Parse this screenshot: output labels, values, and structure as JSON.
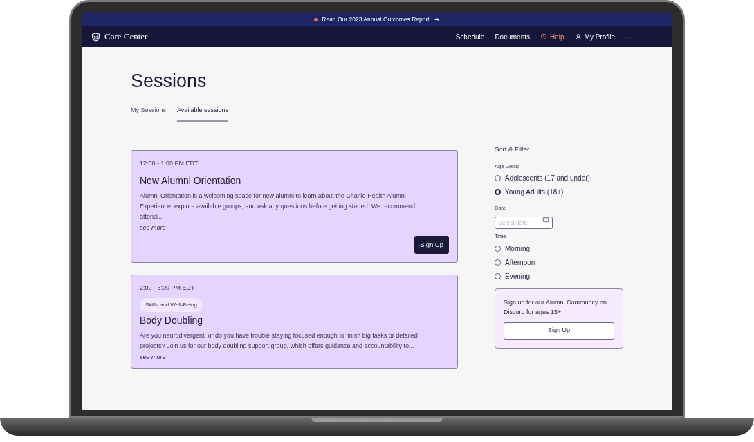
{
  "banner": {
    "text": "Read Our 2023 Annual Outcomes Report"
  },
  "nav": {
    "brand": "Care Center",
    "links": [
      {
        "label": "Schedule",
        "kind": "plain"
      },
      {
        "label": "Documents",
        "kind": "plain"
      },
      {
        "label": "Help",
        "kind": "help"
      },
      {
        "label": "My Profile",
        "kind": "profile"
      },
      {
        "label": "···",
        "kind": "more"
      }
    ]
  },
  "page": {
    "title": "Sessions",
    "tabs": [
      {
        "label": "My Sessions",
        "selected": false
      },
      {
        "label": "Available sessions",
        "selected": true
      }
    ]
  },
  "sessions": [
    {
      "time": "12:00 - 1:00 PM EDT",
      "title": "New Alumni Orientation",
      "description": "Alumni Orientation is a welcoming space for new alumni to learn about the Charlie Health Alumni Experience, explore available groups, and ask any questions before getting started. We recommend attendi...",
      "see_more": "see more",
      "button": "Sign Up"
    },
    {
      "time": "2:00 - 3:00 PM EDT",
      "tag": "Skills and Well-Being",
      "title": "Body Doubling",
      "description": "Are you neurodivergent, or do you have trouble staying focused enough to finish big tasks or detailed projects? Join us for our body doubling support group, which offers guidance and accountability to...",
      "see_more": "see more"
    }
  ],
  "filter": {
    "title": "Sort & Filter",
    "age_group": {
      "label": "Age Group",
      "options": [
        {
          "label": "Adolescents (17 and under)",
          "selected": false
        },
        {
          "label": "Young Adults (18+)",
          "selected": true
        }
      ]
    },
    "date": {
      "label": "Date",
      "placeholder": "Select date"
    },
    "time": {
      "label": "Time",
      "options": [
        {
          "label": "Morning",
          "selected": false
        },
        {
          "label": "Afternoon",
          "selected": false
        },
        {
          "label": "Evening",
          "selected": false
        }
      ]
    }
  },
  "community": {
    "text": "Sign up for our Alumni Community on Discord for ages 15+",
    "button": "Sign Up"
  }
}
